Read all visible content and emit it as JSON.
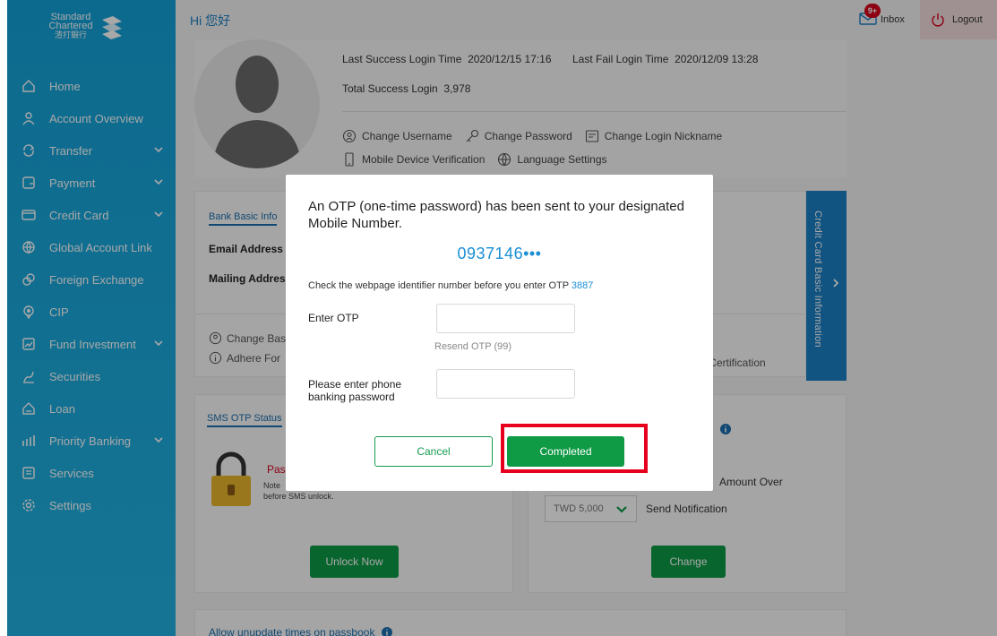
{
  "brand": {
    "line1": "Standard",
    "line2": "Chartered",
    "line3": "渣打銀行"
  },
  "greeting": "Hi 您好",
  "topbar": {
    "inbox_label": "Inbox",
    "inbox_badge": "9+",
    "logout_label": "Logout"
  },
  "sidebar": {
    "items": [
      {
        "label": "Home",
        "icon": "home-icon",
        "has_submenu": false
      },
      {
        "label": "Account Overview",
        "icon": "person-icon",
        "has_submenu": false
      },
      {
        "label": "Transfer",
        "icon": "transfer-icon",
        "has_submenu": true
      },
      {
        "label": "Payment",
        "icon": "payment-icon",
        "has_submenu": true
      },
      {
        "label": "Credit Card",
        "icon": "credit-card-icon",
        "has_submenu": true
      },
      {
        "label": "Global Account Link",
        "icon": "globe-icon",
        "has_submenu": false
      },
      {
        "label": "Foreign Exchange",
        "icon": "exchange-icon",
        "has_submenu": false
      },
      {
        "label": "CIP",
        "icon": "cip-icon",
        "has_submenu": false
      },
      {
        "label": "Fund Investment",
        "icon": "fund-icon",
        "has_submenu": true
      },
      {
        "label": "Securities",
        "icon": "securities-icon",
        "has_submenu": false
      },
      {
        "label": "Loan",
        "icon": "loan-icon",
        "has_submenu": false
      },
      {
        "label": "Priority Banking",
        "icon": "priority-icon",
        "has_submenu": true
      },
      {
        "label": "Services",
        "icon": "services-icon",
        "has_submenu": false
      },
      {
        "label": "Settings",
        "icon": "settings-icon",
        "has_submenu": false
      }
    ]
  },
  "profile": {
    "last_success_label": "Last Success Login Time",
    "last_success_value": "2020/12/15 17:16",
    "last_fail_label": "Last Fail Login Time",
    "last_fail_value": "2020/12/09 13:28",
    "total_success_label": "Total Success Login",
    "total_success_value": "3,978",
    "actions": [
      "Change Username",
      "Change Password",
      "Change Login Nickname",
      "Mobile Device Verification",
      "Language Settings"
    ]
  },
  "bank_info": {
    "title": "Bank Basic Info",
    "email_label": "Email Address",
    "mailing_label": "Mailing Addres",
    "change_label": "Change Bas",
    "adhere_label": "Adhere For",
    "self_cert": "lf Certification"
  },
  "credit_card_tab": "Credit Card Basic Information",
  "sms": {
    "title": "SMS OTP Status",
    "status": "Pass",
    "note_line1": "Note",
    "note_line2": "before SMS unlock.",
    "button": "Unlock Now"
  },
  "notify": {
    "amount_over": "Amount Over",
    "currency_select": "TWD 5,000",
    "send_label": "Send Notification",
    "button": "Change"
  },
  "passbook": {
    "title": "Allow unupdate times on passbook"
  },
  "modal": {
    "title": "An OTP (one-time password) has been sent to your designated Mobile Number.",
    "phone": "0937146•••",
    "check_text": "Check the webpage identifier number before you enter OTP",
    "identifier": "3887",
    "otp_label": "Enter OTP",
    "otp_value": "",
    "resend": "Resend OTP (99)",
    "pwd_label": "Please enter phone banking password",
    "pwd_value": "",
    "cancel": "Cancel",
    "complete": "Completed"
  },
  "colors": {
    "sidebar": "#14a2d9",
    "accent": "#1a7fc4",
    "green": "#0f9a46",
    "alert": "#e6001e"
  }
}
